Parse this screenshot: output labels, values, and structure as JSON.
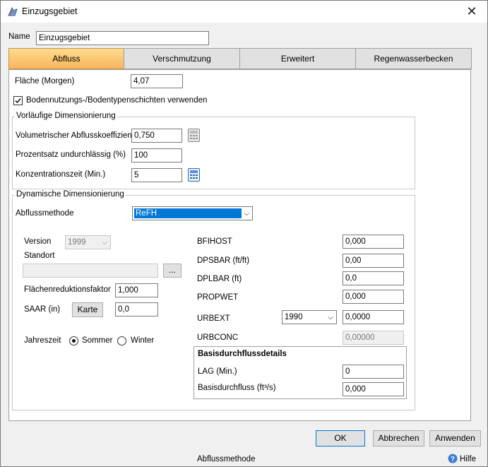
{
  "window": {
    "title": "Einzugsgebiet",
    "close_glyph": "✕"
  },
  "name_field": {
    "label": "Name",
    "value": "Einzugsgebiet"
  },
  "tabs": [
    {
      "label": "Abfluss"
    },
    {
      "label": "Verschmutzung"
    },
    {
      "label": "Erweitert"
    },
    {
      "label": "Regenwasserbecken"
    }
  ],
  "area": {
    "label": "Fläche (Morgen)",
    "value": "4,07"
  },
  "soil_checkbox": {
    "label": "Bodennutzungs-/Bodentypenschichten verwenden",
    "checked": true
  },
  "prelim": {
    "legend": "Vorläufige Dimensionierung",
    "runoff_coeff": {
      "label": "Volumetrischer Abflusskoeffizient",
      "value": "0,750"
    },
    "impervious": {
      "label": "Prozentsatz undurchlässig (%)",
      "value": "100"
    },
    "concentration": {
      "label": "Konzentrationszeit (Min.)",
      "value": "5"
    }
  },
  "dynamic": {
    "legend": "Dynamische Dimensionierung",
    "method": {
      "label": "Abflussmethode",
      "value": "ReFH"
    },
    "version": {
      "label": "Version",
      "value": "1999"
    },
    "location": {
      "label": "Standort",
      "browse_label": "..."
    },
    "area_reduction": {
      "label": "Flächenreduktionsfaktor",
      "value": "1,000"
    },
    "saar": {
      "label": "SAAR (in)",
      "map_button": "Karte",
      "value": "0,0"
    },
    "season": {
      "label": "Jahreszeit",
      "summer": "Sommer",
      "winter": "Winter",
      "selected": "summer"
    },
    "bfihost": {
      "label": "BFIHOST",
      "value": "0,000"
    },
    "dpsbar": {
      "label": "DPSBAR (ft/ft)",
      "value": "0,00"
    },
    "dplbar": {
      "label": "DPLBAR (ft)",
      "value": "0,0"
    },
    "propwet": {
      "label": "PROPWET",
      "value": "0,000"
    },
    "urbext": {
      "label": "URBEXT",
      "year": "1990",
      "value": "0,0000"
    },
    "urbconc": {
      "label": "URBCONC",
      "value": "0,00000"
    },
    "baseflow": {
      "legend": "Basisdurchflussdetails",
      "lag": {
        "label": "LAG (Min.)",
        "value": "0"
      },
      "rate": {
        "label": "Basisdurchfluss (ft³/s)",
        "value": "0,000"
      }
    }
  },
  "buttons": {
    "ok": "OK",
    "cancel": "Abbrechen",
    "apply": "Anwenden"
  },
  "status": {
    "text": "Abflussmethode",
    "help": "Hilfe"
  },
  "colors": {
    "active_tab": "#f9b45c",
    "selection": "#0078d7"
  }
}
